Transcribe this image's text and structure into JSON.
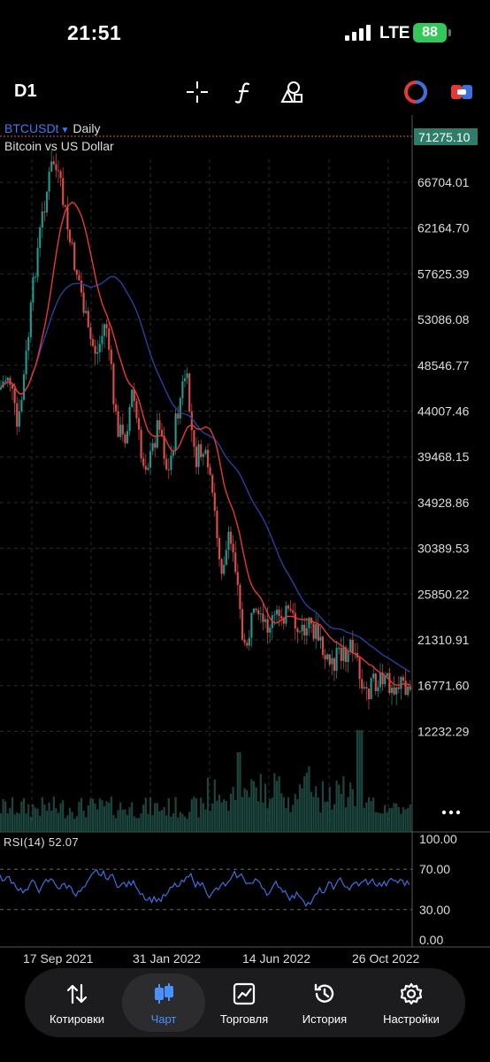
{
  "status_bar": {
    "time": "21:51",
    "network": "LTE",
    "battery": "88"
  },
  "toolbar": {
    "timeframe": "D1"
  },
  "symbol": {
    "name": "BTCUSDt",
    "period": "Daily",
    "description": "Bitcoin vs US Dollar"
  },
  "price_axis": {
    "current": "71275.10",
    "labels": [
      "66704.01",
      "62164.70",
      "57625.39",
      "53086.08",
      "48546.77",
      "44007.46",
      "39468.15",
      "34928.86",
      "30389.53",
      "25850.22",
      "21310.91",
      "16771.60",
      "12232.29"
    ]
  },
  "rsi": {
    "label": "RSI(14)",
    "value": "52.07",
    "levels": [
      "100.00",
      "70.00",
      "30.00",
      "0.00"
    ]
  },
  "date_axis": [
    "17 Sep 2021",
    "31 Jan 2022",
    "14 Jun 2022",
    "26 Oct 2022"
  ],
  "colors": {
    "bull": "#26a69a",
    "bear": "#ef5350",
    "ma_fast": "#e53935",
    "ma_slow": "#2a3f9e",
    "rsi": "#3d6fe0",
    "accent": "#4a90ff",
    "price_tag": "#2e7d6b"
  },
  "tabs": [
    {
      "label": "Котировки",
      "icon": "sort-arrows-icon"
    },
    {
      "label": "Чарт",
      "icon": "candles-icon",
      "active": true
    },
    {
      "label": "Торговля",
      "icon": "trend-chart-icon"
    },
    {
      "label": "История",
      "icon": "history-clock-icon"
    },
    {
      "label": "Настройки",
      "icon": "gear-icon"
    }
  ]
}
